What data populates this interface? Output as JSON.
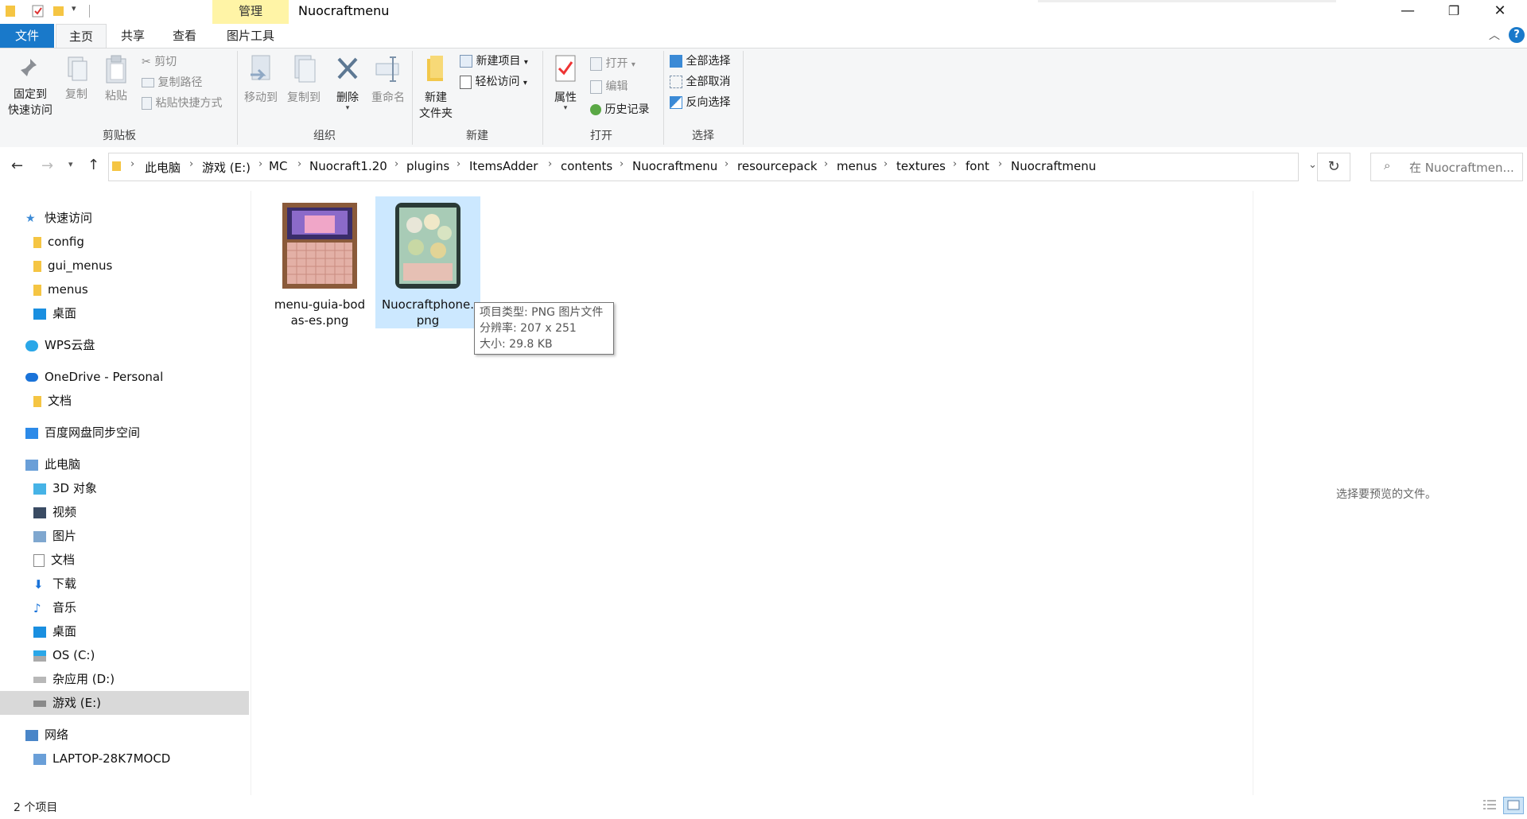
{
  "titlebar": {
    "manage_label": "管理",
    "window_title": "Nuocraftmenu",
    "minimize": "—",
    "restore": "❐",
    "close": "✕"
  },
  "ribbon_tabs": [
    {
      "label": "文件"
    },
    {
      "label": "主页"
    },
    {
      "label": "共享"
    },
    {
      "label": "查看"
    },
    {
      "label": "图片工具"
    }
  ],
  "ribbon": {
    "clipboard": {
      "label": "剪贴板",
      "pin_line1": "固定到",
      "pin_line2": "快速访问",
      "copy": "复制",
      "paste": "粘贴",
      "cut": "剪切",
      "copy_path": "复制路径",
      "paste_shortcut": "粘贴快捷方式"
    },
    "organize": {
      "label": "组织",
      "move_to": "移动到",
      "copy_to": "复制到",
      "delete": "删除",
      "rename": "重命名"
    },
    "new": {
      "label": "新建",
      "new_folder_line1": "新建",
      "new_folder_line2": "文件夹",
      "new_item": "新建项目",
      "easy_access": "轻松访问"
    },
    "open": {
      "label": "打开",
      "properties": "属性",
      "open": "打开",
      "edit": "编辑",
      "history": "历史记录"
    },
    "select": {
      "label": "选择",
      "select_all": "全部选择",
      "select_none": "全部取消",
      "invert": "反向选择"
    }
  },
  "address": {
    "crumbs": [
      "此电脑",
      "游戏 (E:)",
      "MC",
      "Nuocraft1.20",
      "plugins",
      "ItemsAdder",
      "contents",
      "Nuocraftmenu",
      "resourcepack",
      "menus",
      "textures",
      "font",
      "Nuocraftmenu"
    ],
    "search_placeholder": "在 Nuocraftmen..."
  },
  "nav": {
    "quick_access": "快速访问",
    "config": "config",
    "gui_menus": "gui_menus",
    "menus": "menus",
    "desktop1": "桌面",
    "wps": "WPS云盘",
    "onedrive": "OneDrive - Personal",
    "docs1": "文档",
    "baidu": "百度网盘同步空间",
    "this_pc": "此电脑",
    "objects3d": "3D 对象",
    "videos": "视频",
    "pictures": "图片",
    "docs2": "文档",
    "downloads": "下载",
    "music": "音乐",
    "desktop2": "桌面",
    "drive_c": "OS (C:)",
    "drive_d": "杂应用 (D:)",
    "drive_e": "游戏 (E:)",
    "network": "网络",
    "laptop": "LAPTOP-28K7MOCD"
  },
  "files": [
    {
      "name_line1": "menu-guia-bod",
      "name_line2": "as-es.png"
    },
    {
      "name_line1": "Nuocraftphone.",
      "name_line2": "png"
    }
  ],
  "tooltip": {
    "type": "项目类型: PNG 图片文件",
    "resolution": "分辨率: 207 x 251",
    "size": "大小: 29.8 KB"
  },
  "preview_message": "选择要预览的文件。",
  "status": "2 个项目",
  "colors": {
    "accent": "#1979ca",
    "manage_tab": "#fff4a6",
    "selection": "#cce8ff"
  }
}
